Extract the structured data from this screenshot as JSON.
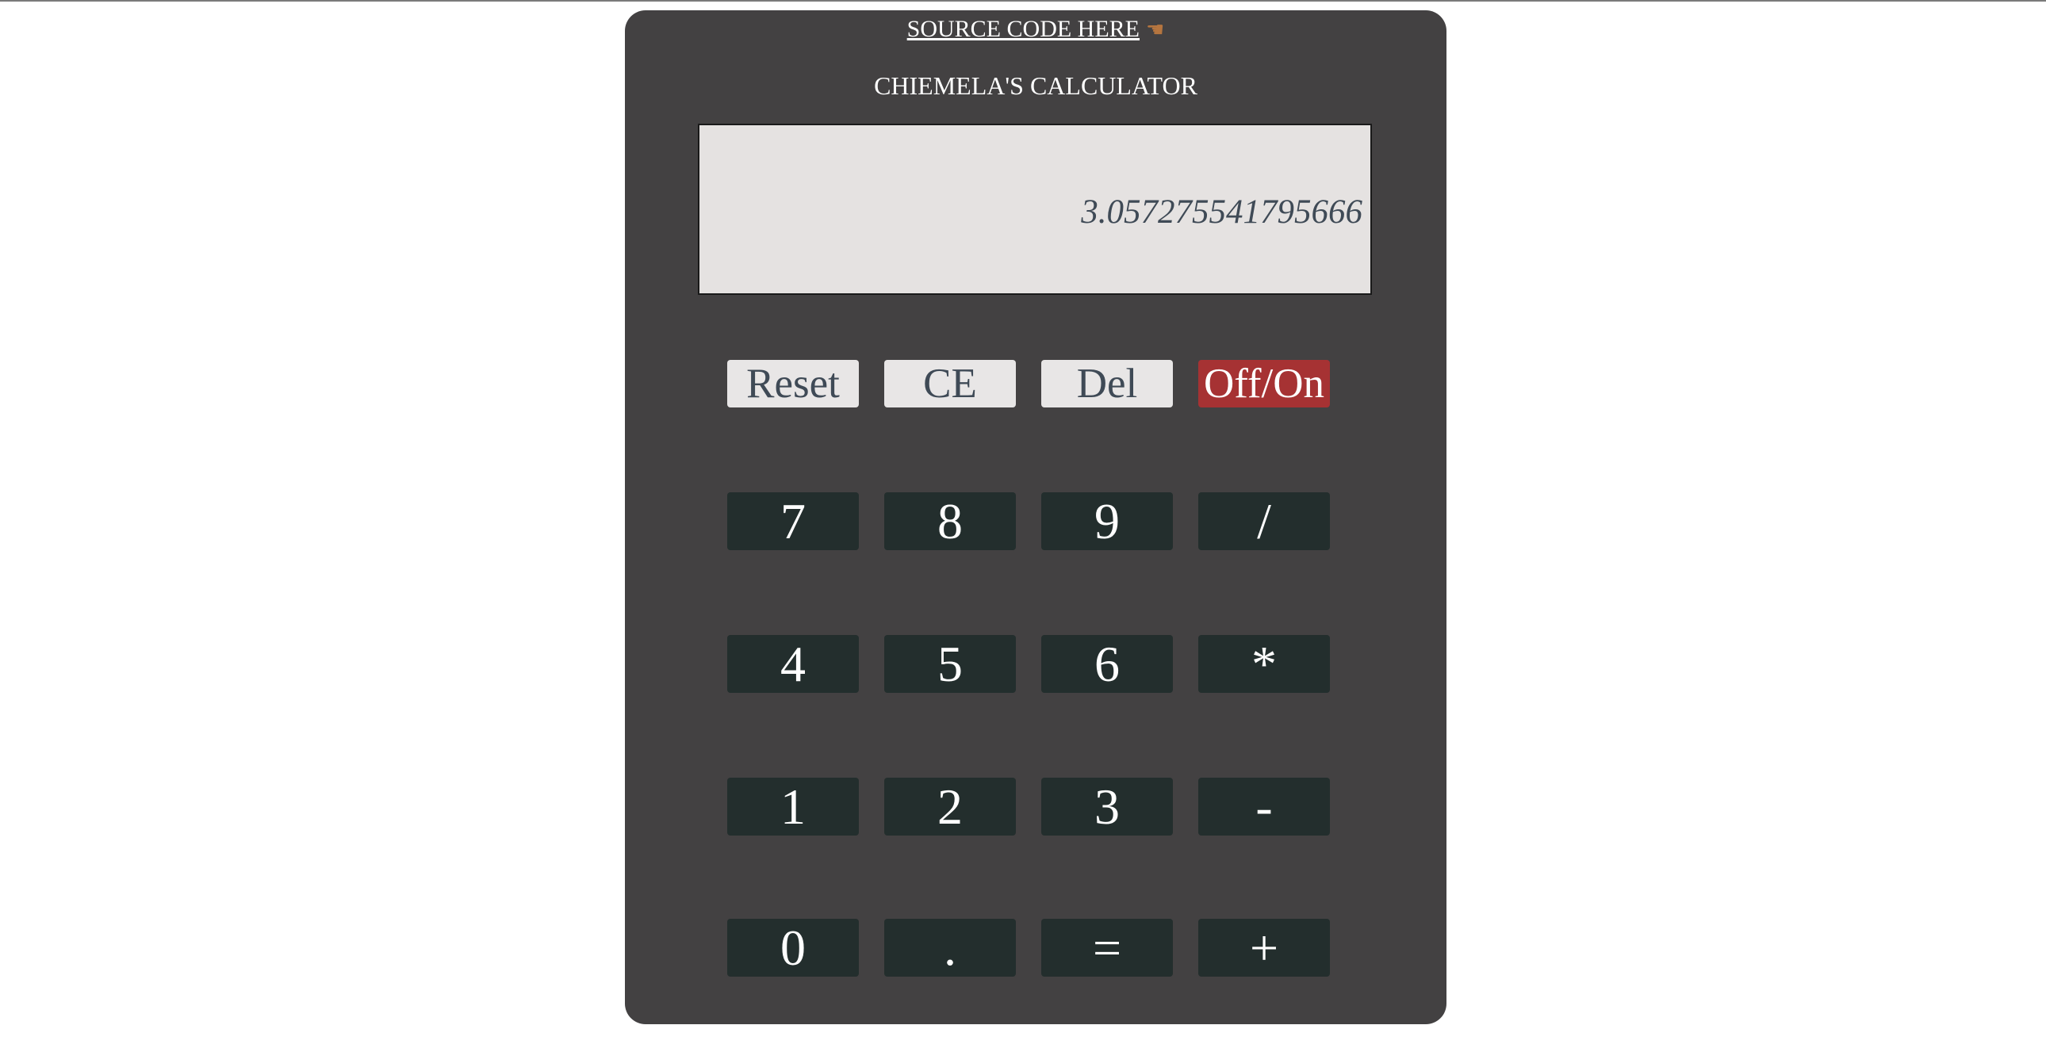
{
  "source_link": {
    "label": "SOURCE CODE HERE",
    "icon": "pointing-hand-icon",
    "icon_glyph": "☚"
  },
  "title": "CHIEMELA'S CALCULATOR",
  "display": {
    "value": "3.057275541795666"
  },
  "function_keys": {
    "reset": "Reset",
    "ce": "CE",
    "del": "Del",
    "power": "Off/On"
  },
  "keypad": {
    "row0": [
      "7",
      "8",
      "9",
      "/"
    ],
    "row1": [
      "4",
      "5",
      "6",
      "*"
    ],
    "row2": [
      "1",
      "2",
      "3",
      "-"
    ],
    "row3": [
      "0",
      ".",
      "=",
      "+"
    ]
  },
  "colors": {
    "body_background": "#434142",
    "display_background": "#e5e2e1",
    "display_text": "#3f4a56",
    "key_background": "#232e2d",
    "function_key_background": "#e8e6e6",
    "power_key_background": "#a63233"
  }
}
